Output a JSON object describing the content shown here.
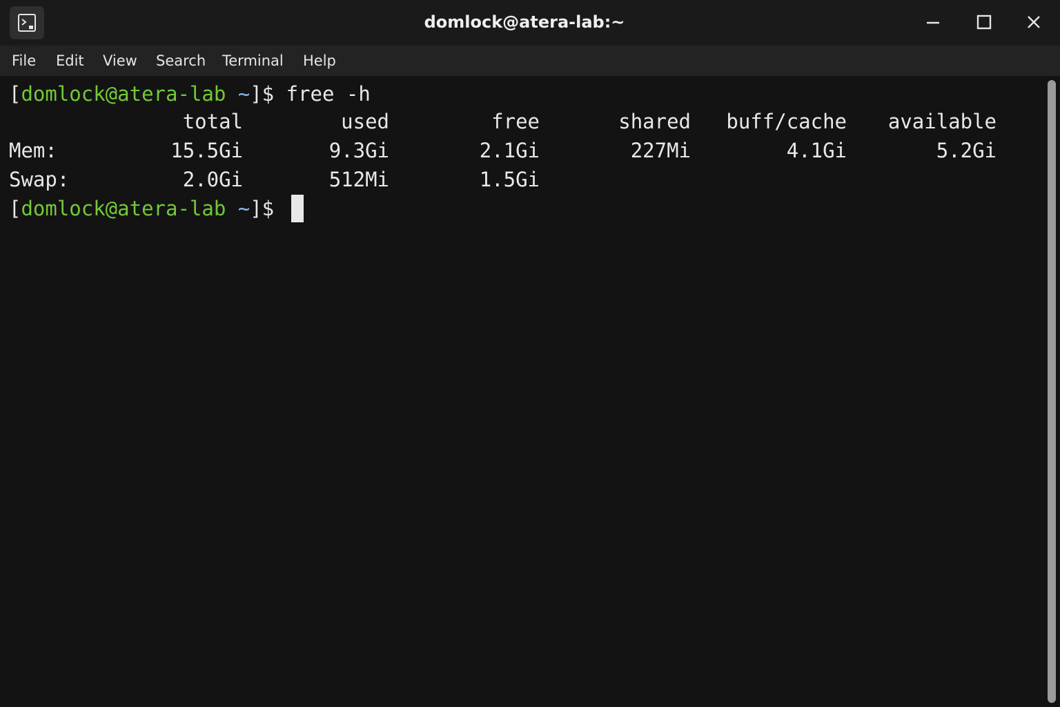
{
  "window": {
    "title": "domlock@atera-lab:~"
  },
  "menu": [
    "File",
    "Edit",
    "View",
    "Search",
    "Terminal",
    "Help"
  ],
  "terminal": {
    "prompt": {
      "open_bracket": "[",
      "user_host": "domlock@atera-lab",
      "dir": "~",
      "close": "]$"
    },
    "command": "free -h",
    "headers": [
      "total",
      "used",
      "free",
      "shared",
      "buff/cache",
      "available"
    ],
    "rows": [
      {
        "label": "Mem:",
        "values": [
          "15.5Gi",
          "9.3Gi",
          "2.1Gi",
          "227Mi",
          "4.1Gi",
          "5.2Gi"
        ]
      },
      {
        "label": "Swap:",
        "values": [
          "2.0Gi",
          "512Mi",
          "1.5Gi",
          "",
          "",
          ""
        ]
      }
    ]
  },
  "icons": {
    "app": "terminal-icon",
    "minimize": "minimize-icon",
    "maximize": "maximize-icon",
    "close": "close-icon"
  },
  "colors": {
    "prompt_user_host": "#73c936",
    "prompt_dir": "#8fb8ec",
    "background": "#131313"
  }
}
